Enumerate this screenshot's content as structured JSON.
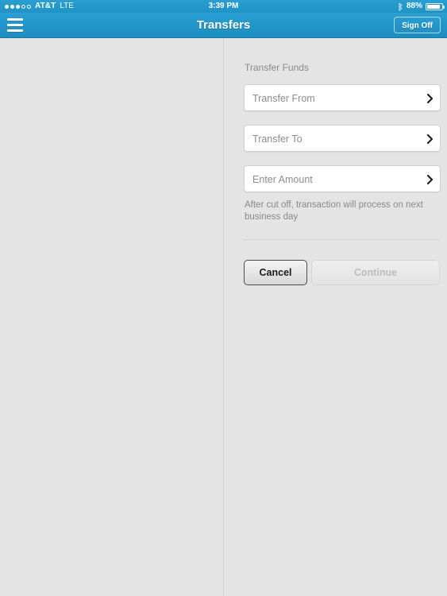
{
  "status_bar": {
    "signal_dots_filled": 3,
    "signal_dots_total": 5,
    "carrier": "AT&T",
    "network": "LTE",
    "time": "3:39 PM",
    "bluetooth_icon": "bluetooth-icon",
    "battery_percent": "88%",
    "battery_level": 88
  },
  "navbar": {
    "menu_icon": "hamburger-menu-icon",
    "title": "Transfers",
    "signoff_label": "Sign Off",
    "background_color": "#2196ca"
  },
  "form": {
    "section_title": "Transfer Funds",
    "fields": [
      {
        "label": "Transfer From",
        "value": "",
        "chevron_icon": "chevron-right-icon"
      },
      {
        "label": "Transfer To",
        "value": "",
        "chevron_icon": "chevron-right-icon"
      },
      {
        "label": "Enter Amount",
        "value": "",
        "chevron_icon": "chevron-right-icon"
      }
    ],
    "helper_text": "After cut off, transaction will process on next business day",
    "buttons": {
      "cancel": "Cancel",
      "continue": "Continue"
    }
  },
  "colors": {
    "accent": "#2196ca",
    "page_background": "#e4e4e4",
    "field_background": "#ffffff",
    "muted_text": "#8a8a8a"
  }
}
